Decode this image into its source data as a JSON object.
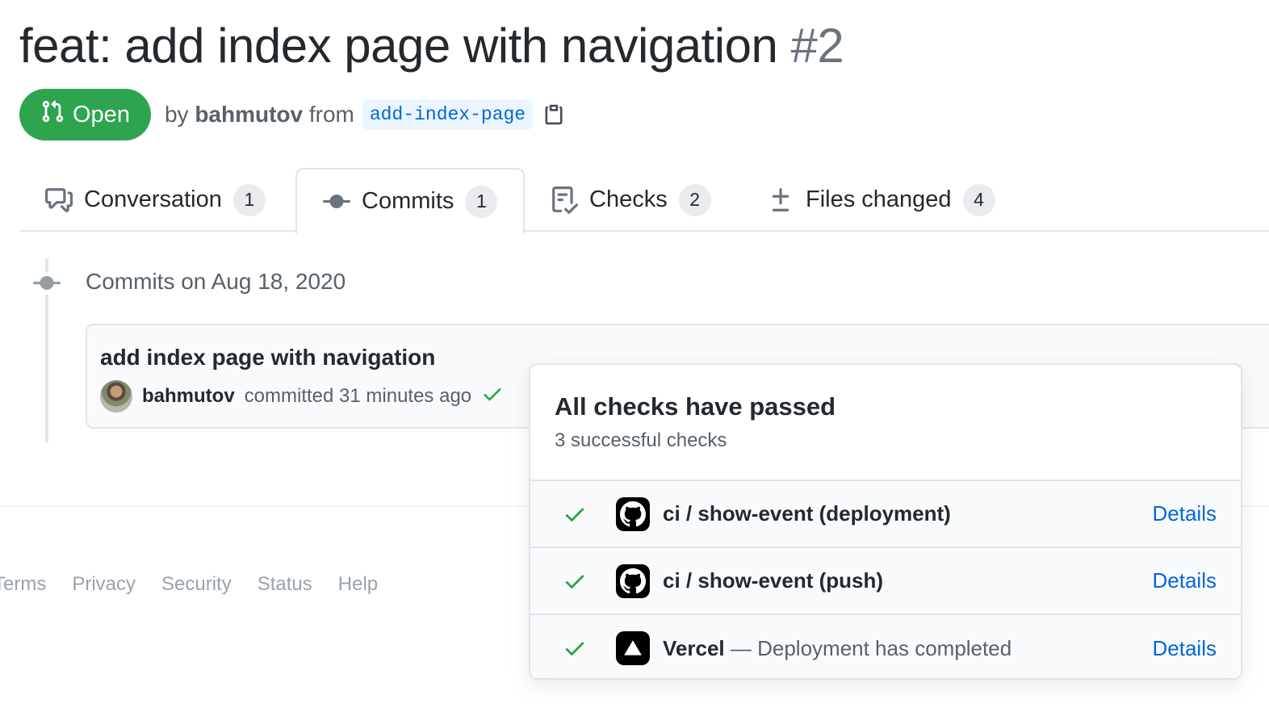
{
  "pr": {
    "title": "feat: add index page with navigation",
    "number": "#2",
    "state_label": "Open",
    "by_label": "by",
    "author": "bahmutov",
    "from_label": "from",
    "branch": "add-index-page"
  },
  "tabs": [
    {
      "label": "Conversation",
      "count": "1",
      "icon": "comment-discussion-icon"
    },
    {
      "label": "Commits",
      "count": "1",
      "icon": "git-commit-icon",
      "selected": true
    },
    {
      "label": "Checks",
      "count": "2",
      "icon": "checklist-icon"
    },
    {
      "label": "Files changed",
      "count": "4",
      "icon": "diff-icon"
    }
  ],
  "commits": {
    "date_heading": "Commits on Aug 18, 2020",
    "title": "add index page with navigation",
    "author": "bahmutov",
    "committed_text": "committed 31 minutes ago"
  },
  "footer": {
    "links": [
      "Terms",
      "Privacy",
      "Security",
      "Status",
      "Help"
    ]
  },
  "checks_popover": {
    "title": "All checks have passed",
    "subtitle": "3 successful checks",
    "checks": [
      {
        "name": "ci / show-event (deployment)",
        "description": "",
        "app_icon": "github-icon",
        "link": "Details"
      },
      {
        "name": "ci / show-event (push)",
        "description": "",
        "app_icon": "github-icon",
        "link": "Details"
      },
      {
        "name": "Vercel",
        "description": "— Deployment has completed",
        "app_icon": "vercel-icon",
        "link": "Details"
      }
    ]
  },
  "colors": {
    "open_green": "#2ea44f",
    "link_blue": "#0366d6",
    "check_green": "#28a745"
  }
}
